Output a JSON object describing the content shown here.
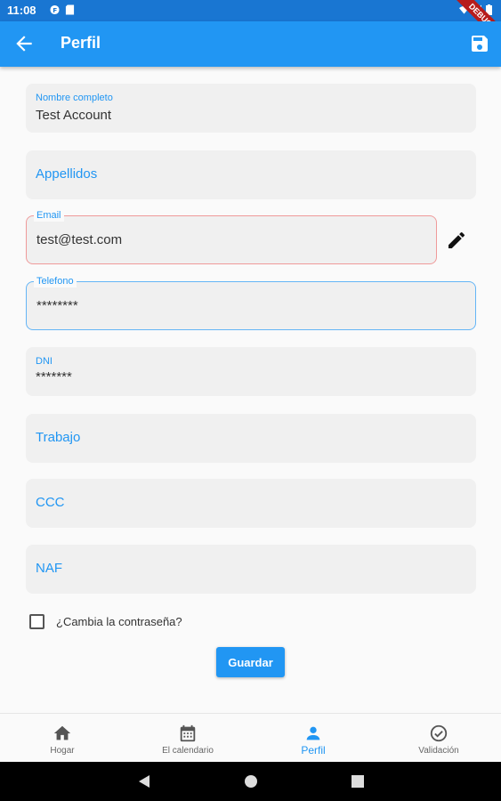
{
  "status_bar": {
    "time": "11:08",
    "debug_label": "DEBUG"
  },
  "app_bar": {
    "title": "Perfil"
  },
  "form": {
    "nombre": {
      "label": "Nombre completo",
      "value": "Test Account"
    },
    "apellidos": {
      "placeholder": "Appellidos"
    },
    "email": {
      "label": "Email",
      "value": "test@test.com"
    },
    "telefono": {
      "label": "Telefono",
      "value": "********"
    },
    "dni": {
      "label": "DNI",
      "value": "*******"
    },
    "trabajo": {
      "placeholder": "Trabajo"
    },
    "ccc": {
      "placeholder": "CCC"
    },
    "naf": {
      "placeholder": "NAF"
    },
    "change_password_label": "¿Cambia la contraseña?",
    "save_label": "Guardar"
  },
  "colors": {
    "primary": "#2196f3",
    "status_bar": "#1976d2",
    "error_outline": "#ef9a9a"
  },
  "bottom_nav": {
    "items": [
      {
        "label": "Hogar",
        "icon": "home-icon"
      },
      {
        "label": "El calendario",
        "icon": "calendar-icon"
      },
      {
        "label": "Perfil",
        "icon": "person-icon",
        "active": true
      },
      {
        "label": "Validación",
        "icon": "check-circle-icon"
      }
    ]
  }
}
